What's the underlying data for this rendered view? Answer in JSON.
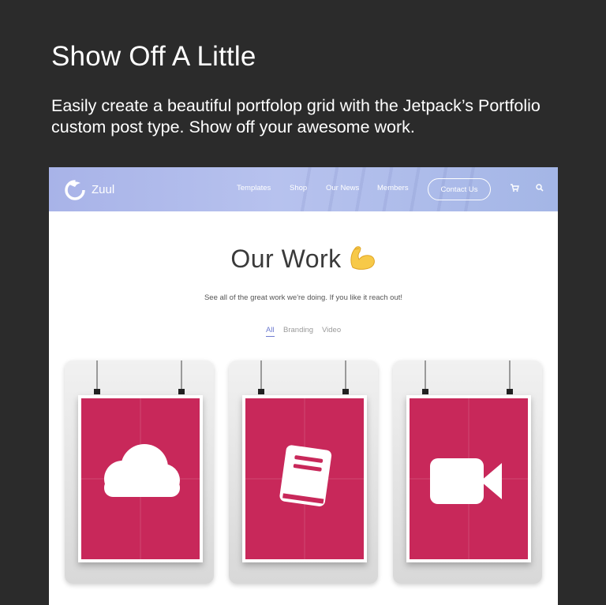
{
  "promo": {
    "headline": "Show Off A Little",
    "subtext": "Easily create a beautiful portfolop grid with the Jetpack’s Portfolio custom post type. Show off your awesome work."
  },
  "site": {
    "logo_text": "Zuul",
    "nav": [
      "Templates",
      "Shop",
      "Our News",
      "Members"
    ],
    "contact_label": "Contact Us",
    "title": "Our Work",
    "title_emoji": "flexed-biceps-emoji",
    "subtitle": "See all of the great work we're doing. If you like it reach out!",
    "filters": [
      "All",
      "Branding",
      "Video"
    ],
    "active_filter": "All"
  },
  "portfolio": [
    {
      "icon": "cloud-icon"
    },
    {
      "icon": "book-icon"
    },
    {
      "icon": "video-camera-icon"
    }
  ],
  "colors": {
    "background": "#2b2b2b",
    "poster": "#c8285a",
    "accent": "#6e7bd0"
  }
}
